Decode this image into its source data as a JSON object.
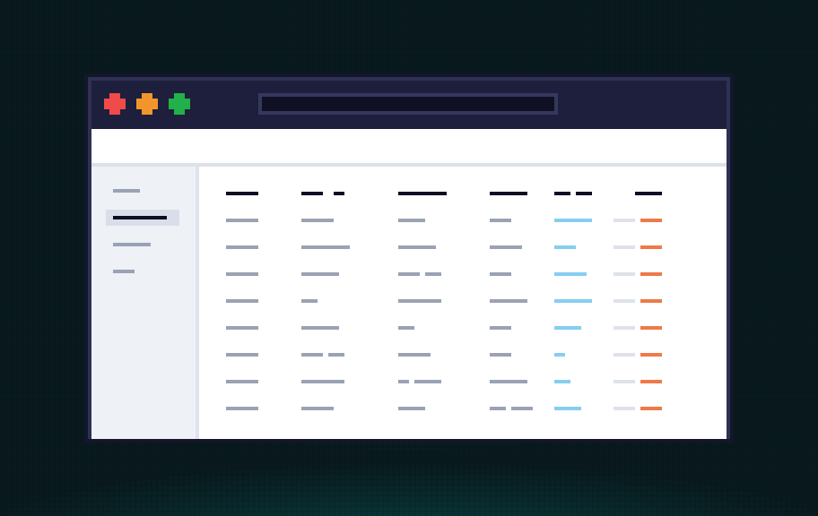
{
  "window": {
    "controls": [
      "close",
      "minimize",
      "maximize"
    ],
    "url": ""
  },
  "sidebar": {
    "items": [
      {
        "active": false
      },
      {
        "active": true
      },
      {
        "active": false
      },
      {
        "active": false
      }
    ]
  },
  "table": {
    "columns": 6,
    "rows": 8
  },
  "colors": {
    "close": "#f04a4a",
    "minimize": "#f2952c",
    "maximize": "#22b04a",
    "header_text": "#0d0e24",
    "cell_text": "#9aa2b4",
    "link_blue": "#86cdf2",
    "badge_gray": "#dde2ea",
    "badge_orange": "#ef7a48"
  }
}
